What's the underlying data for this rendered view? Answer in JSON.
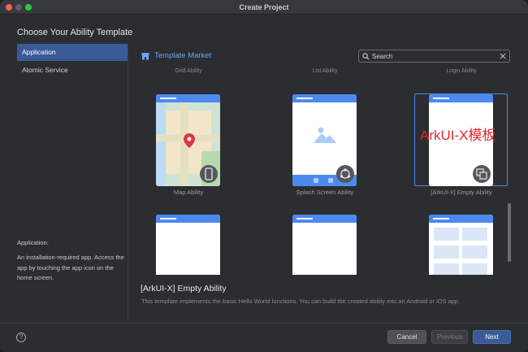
{
  "window": {
    "title": "Create Project"
  },
  "heading": "Choose Your Ability Template",
  "sidebar": {
    "items": [
      {
        "label": "Application",
        "active": true
      },
      {
        "label": "Atomic Service",
        "active": false
      }
    ]
  },
  "description": {
    "title": "Application:",
    "text": "An installation-required app. Access the app by touching the app icon on the home screen."
  },
  "market": {
    "label": "Template Market",
    "icon": "store-icon"
  },
  "search": {
    "placeholder": "Search",
    "value": ""
  },
  "top_row_labels": [
    "Grid Ability",
    "List Ability",
    "Login Ability"
  ],
  "templates": [
    {
      "caption": "Map Ability",
      "badge_icon": "phone-icon"
    },
    {
      "caption": "Splash Screen Ability",
      "badge_icon": "multi-device-icon"
    },
    {
      "caption": "[ArkUI-X] Empty Ability",
      "badge_icon": "cross-platform-icon",
      "selected": true,
      "overlay_text": "ArkUI-X模板"
    }
  ],
  "detail": {
    "title": "[ArkUI-X] Empty Ability",
    "text": "This template implements the basic Hello World functions. You can build the created ability into an Android or iOS app."
  },
  "buttons": {
    "help": "?",
    "cancel": "Cancel",
    "previous": "Previous",
    "next": "Next"
  },
  "colors": {
    "accent": "#3a5b97",
    "link": "#6ea3f7",
    "card_header": "#4d8af0",
    "overlay_red": "#e4252c"
  }
}
